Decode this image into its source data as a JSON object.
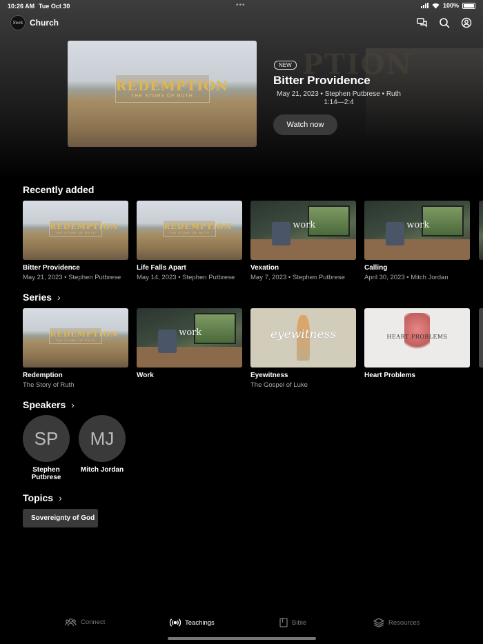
{
  "status_bar": {
    "time": "10:26 AM",
    "date": "Tue Oct 30",
    "battery": "100%"
  },
  "header": {
    "church_name": "Church",
    "logo_text": "Seek",
    "icons": [
      "chat-icon",
      "search-icon",
      "profile-icon"
    ]
  },
  "hero": {
    "badge": "NEW",
    "title": "Bitter Providence",
    "meta": "May 21, 2023 • Stephen Putbrese • Ruth 1:14—2:4",
    "watch_label": "Watch now",
    "image_title": "REDEMPTION",
    "image_subtitle": "THE STORY OF RUTH",
    "ghost_text": "PTION"
  },
  "recently_added": {
    "title": "Recently added",
    "items": [
      {
        "title": "Bitter Providence",
        "subtitle": "May 21, 2023 • Stephen Putbrese",
        "thumb": "redemption"
      },
      {
        "title": "Life Falls Apart",
        "subtitle": "May 14, 2023 • Stephen Putbrese",
        "thumb": "redemption"
      },
      {
        "title": "Vexation",
        "subtitle": "May 7, 2023 • Stephen Putbrese",
        "thumb": "work"
      },
      {
        "title": "Calling",
        "subtitle": "April 30, 2023 • Mitch Jordan",
        "thumb": "work"
      }
    ]
  },
  "series": {
    "title": "Series",
    "items": [
      {
        "title": "Redemption",
        "subtitle": "The Story of Ruth",
        "thumb": "redemption"
      },
      {
        "title": "Work",
        "subtitle": "",
        "thumb": "work"
      },
      {
        "title": "Eyewitness",
        "subtitle": "The Gospel of Luke",
        "thumb": "eyewitness",
        "image_text": "eyewitness"
      },
      {
        "title": "Heart Problems",
        "subtitle": "",
        "thumb": "heart",
        "image_text": "HEART PROBLEMS"
      }
    ]
  },
  "speakers": {
    "title": "Speakers",
    "items": [
      {
        "initials": "SP",
        "name": "Stephen Putbrese"
      },
      {
        "initials": "MJ",
        "name": "Mitch Jordan"
      }
    ]
  },
  "topics": {
    "title": "Topics",
    "items": [
      "Sovereignty of God"
    ]
  },
  "tab_bar": {
    "items": [
      {
        "label": "Connect",
        "icon": "people-icon",
        "active": false
      },
      {
        "label": "Teachings",
        "icon": "broadcast-icon",
        "active": true
      },
      {
        "label": "Bible",
        "icon": "book-icon",
        "active": false
      },
      {
        "label": "Resources",
        "icon": "layers-icon",
        "active": false
      }
    ]
  },
  "thumb_text": {
    "work": "work",
    "redemption_title": "REDEMPTION",
    "redemption_sub": "THE STORY OF RUTH"
  },
  "colors": {
    "background": "#000000",
    "card": "#3a3a3a",
    "accent_gold": "#e4b64a"
  }
}
